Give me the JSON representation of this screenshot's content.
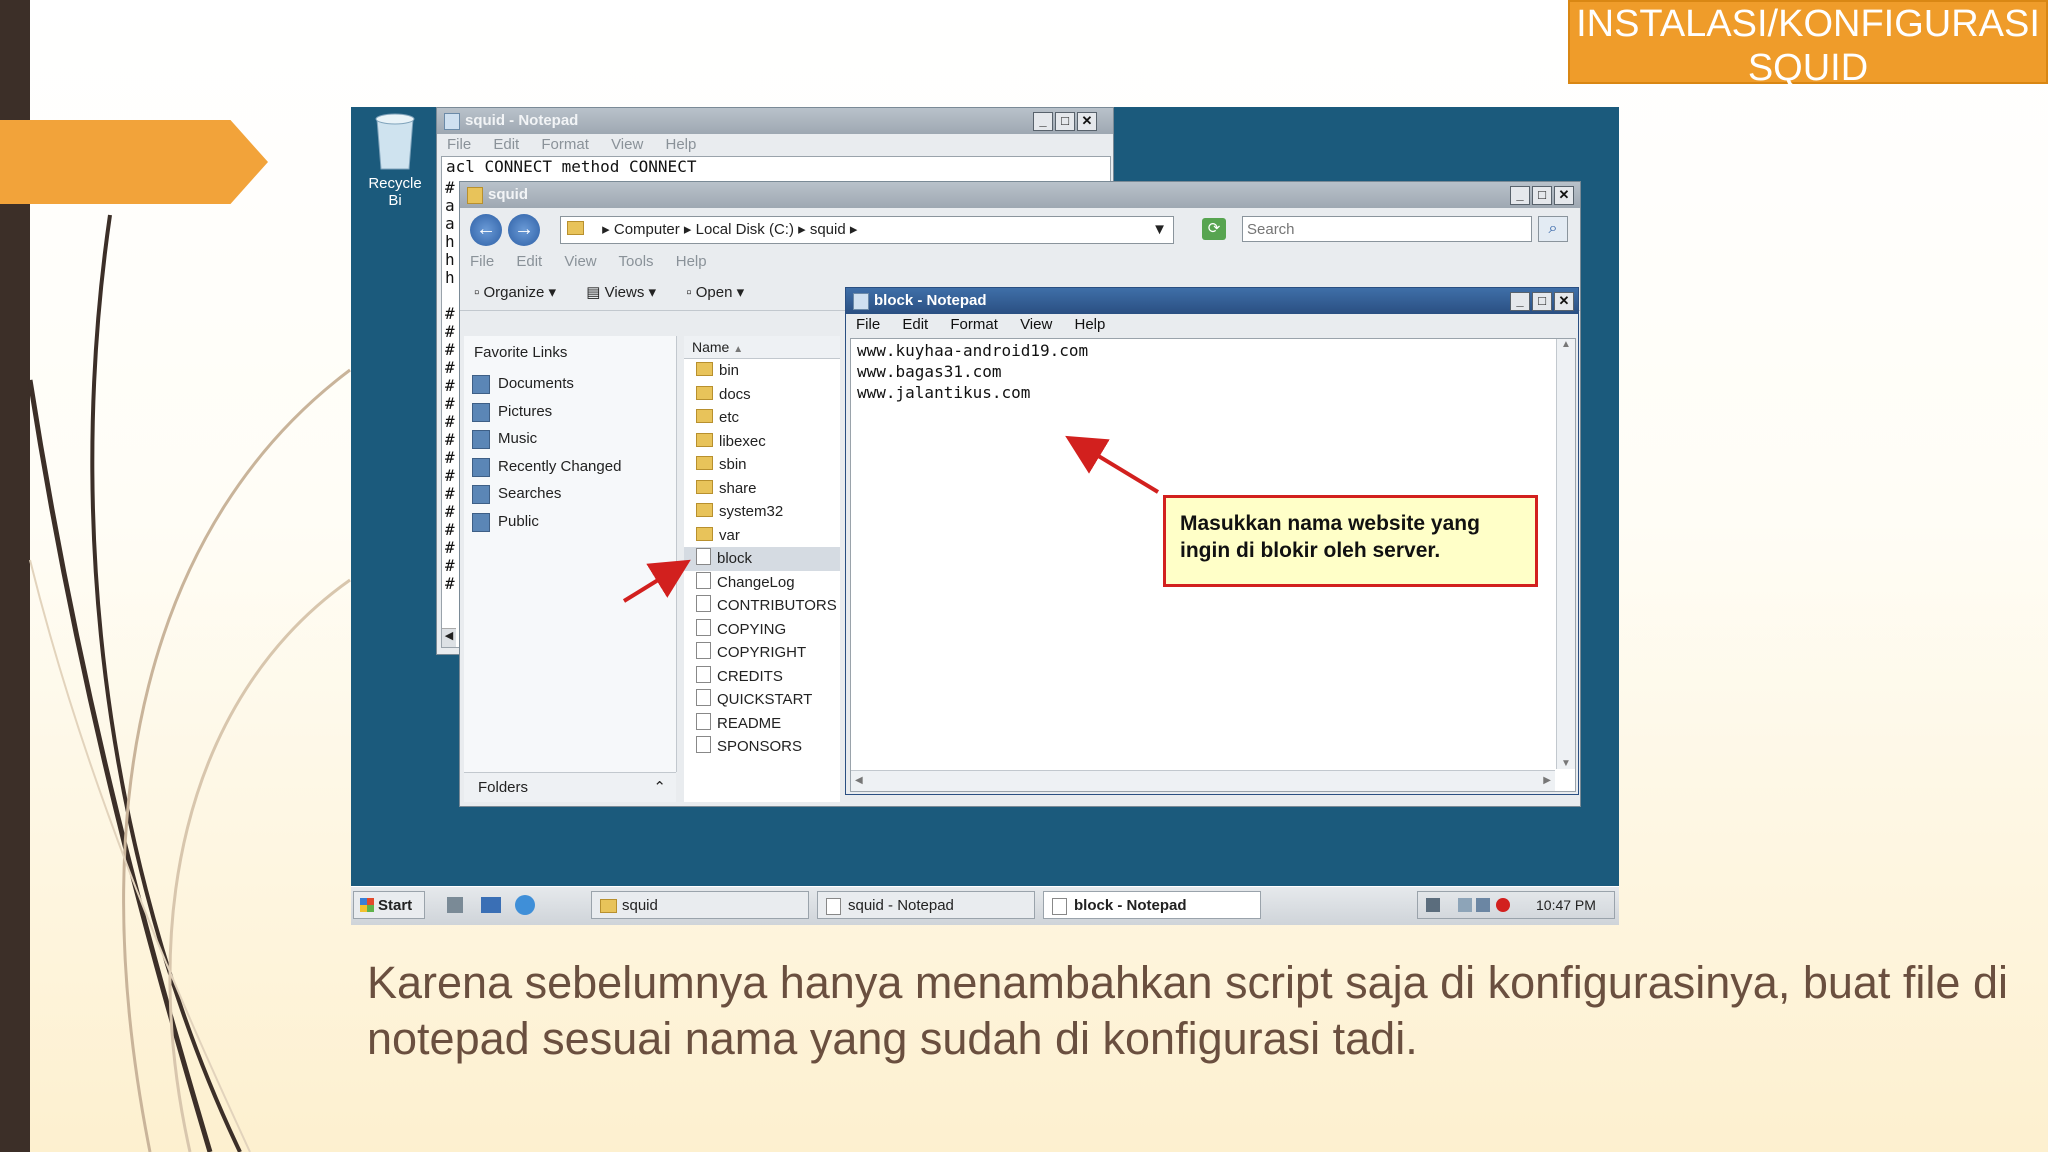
{
  "slide": {
    "title": "INSTALASI/KONFIGURASI SQUID",
    "caption": "Karena sebelumnya hanya menambahkan script saja di konfigurasinya, buat file di notepad sesuai nama yang sudah di konfigurasi tadi."
  },
  "desktop": {
    "recycle_bin_label": "Recycle Bi"
  },
  "squid_notepad": {
    "title": "squid - Notepad",
    "menu": [
      "File",
      "Edit",
      "Format",
      "View",
      "Help"
    ],
    "first_line": "acl CONNECT method CONNECT",
    "margin_chars": [
      "#",
      "a",
      "a",
      "h",
      "h",
      "h",
      "",
      "#",
      "#",
      "#",
      "#",
      "#",
      "#",
      "#",
      "#",
      "#",
      "#",
      "#",
      "#",
      "#",
      "#",
      "#",
      "#"
    ]
  },
  "explorer": {
    "title": "squid",
    "address": [
      "Computer",
      "Local Disk (C:)",
      "squid"
    ],
    "search_placeholder": "Search",
    "menu": [
      "File",
      "Edit",
      "View",
      "Tools",
      "Help"
    ],
    "toolbar": {
      "organize": "Organize",
      "views": "Views",
      "open": "Open"
    },
    "favorite_links_header": "Favorite Links",
    "favorite_links": [
      "Documents",
      "Pictures",
      "Music",
      "Recently Changed",
      "Searches",
      "Public"
    ],
    "folders_label": "Folders",
    "name_header": "Name",
    "items": [
      {
        "name": "bin",
        "type": "folder"
      },
      {
        "name": "docs",
        "type": "folder"
      },
      {
        "name": "etc",
        "type": "folder"
      },
      {
        "name": "libexec",
        "type": "folder"
      },
      {
        "name": "sbin",
        "type": "folder"
      },
      {
        "name": "share",
        "type": "folder"
      },
      {
        "name": "system32",
        "type": "folder"
      },
      {
        "name": "var",
        "type": "folder"
      },
      {
        "name": "block",
        "type": "file",
        "selected": true
      },
      {
        "name": "ChangeLog",
        "type": "file"
      },
      {
        "name": "CONTRIBUTORS",
        "type": "file"
      },
      {
        "name": "COPYING",
        "type": "file"
      },
      {
        "name": "COPYRIGHT",
        "type": "file"
      },
      {
        "name": "CREDITS",
        "type": "file"
      },
      {
        "name": "QUICKSTART",
        "type": "file"
      },
      {
        "name": "README",
        "type": "file"
      },
      {
        "name": "SPONSORS",
        "type": "file"
      }
    ]
  },
  "block_notepad": {
    "title": "block - Notepad",
    "menu": [
      "File",
      "Edit",
      "Format",
      "View",
      "Help"
    ],
    "lines": [
      "www.kuyhaa-android19.com",
      "www.bagas31.com",
      "www.jalantikus.com"
    ]
  },
  "callout": {
    "text": "Masukkan nama website yang ingin di blokir oleh server."
  },
  "taskbar": {
    "start": "Start",
    "buttons": [
      "squid",
      "squid - Notepad",
      "block - Notepad"
    ],
    "active_button": "block - Notepad",
    "clock": "10:47 PM"
  },
  "colors": {
    "accent_orange": "#ef9c2a",
    "desktop_blue": "#1b5a7c",
    "callout_border": "#d2201e",
    "caption_brown": "#6a4f3f"
  }
}
